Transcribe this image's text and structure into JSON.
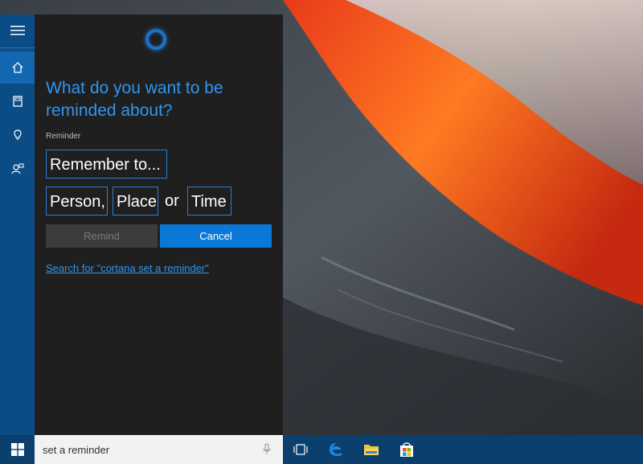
{
  "cortana": {
    "question": "What do you want to be reminded about?",
    "field_label": "Reminder",
    "chips": {
      "remember": "Remember to...",
      "person": "Person,",
      "place": "Place",
      "or": "or",
      "time": "Time"
    },
    "remind_label": "Remind",
    "cancel_label": "Cancel",
    "search_link": "Search for \"cortana set a reminder\""
  },
  "taskbar": {
    "search_value": "set a reminder"
  },
  "colors": {
    "accent": "#0b78d7",
    "link": "#2f96ee",
    "rail": "#0a4c86",
    "panel": "#1f1f1f"
  },
  "icons": {
    "rail": [
      "hamburger-menu-icon",
      "home-icon",
      "notebook-icon",
      "reminders-icon",
      "feedback-icon"
    ],
    "taskbar": [
      "windows-logo-icon",
      "microphone-icon",
      "task-view-icon",
      "edge-icon",
      "file-explorer-icon",
      "store-icon"
    ],
    "cortana": "cortana-ring-icon"
  }
}
